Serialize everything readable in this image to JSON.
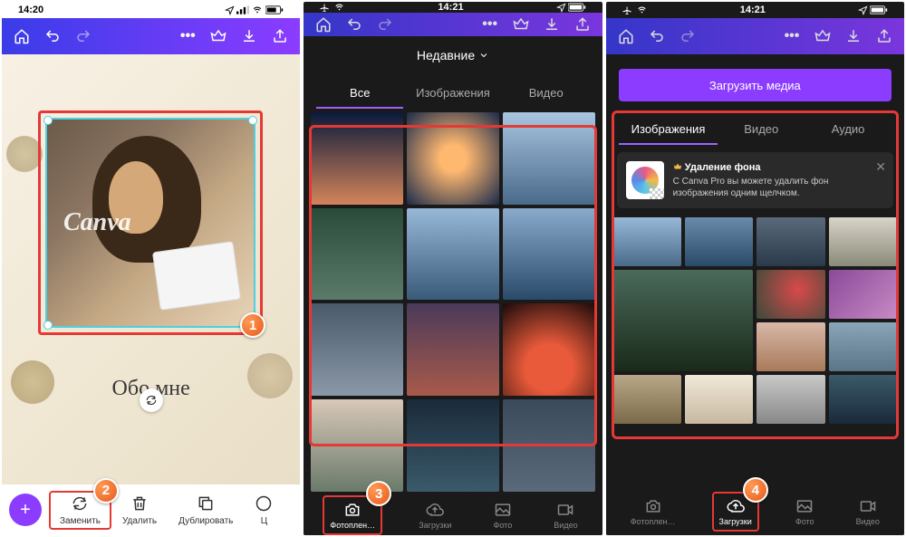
{
  "status": {
    "time1": "14:20",
    "time2": "14:21",
    "time3": "14:21",
    "signal_icon": "signal",
    "wifi_icon": "wifi",
    "battery_icon": "battery",
    "plane_icon": "airplane",
    "location_icon": "location"
  },
  "toolbar": {
    "home": "home",
    "undo": "undo",
    "redo": "redo",
    "more": "•••",
    "crown": "crown",
    "download": "download",
    "share": "share"
  },
  "panel1": {
    "watermark": "Canva",
    "caption": "Обо мне",
    "fab": "+",
    "tools": {
      "replace": "Заменить",
      "delete": "Удалить",
      "duplicate": "Дублировать",
      "color_partial": "Ц"
    },
    "step1": "1",
    "step2": "2"
  },
  "panel2": {
    "dropdown": "Недавние",
    "tabs": {
      "all": "Все",
      "images": "Изображения",
      "video": "Видео"
    },
    "nav": {
      "camera": "Фотоплен…",
      "uploads": "Загрузки",
      "photo": "Фото",
      "video": "Видео"
    },
    "step3": "3"
  },
  "panel3": {
    "upload": "Загрузить медиа",
    "tabs": {
      "images": "Изображения",
      "video": "Видео",
      "audio": "Аудио"
    },
    "promo": {
      "title": "Удаление фона",
      "desc": "С Canva Pro вы можете удалить фон изображения одним щелчком.",
      "close": "✕"
    },
    "nav": {
      "camera": "Фотоплен…",
      "uploads": "Загрузки",
      "photo": "Фото",
      "video": "Видео"
    },
    "step4": "4"
  },
  "thumbs2": [
    "linear-gradient(180deg,#0a1a3a,#d4845a)",
    "radial-gradient(ellipse at center,#ffb870 20%,#1a2a4a)",
    "linear-gradient(180deg,#a8c4e0,#4a6a8a)",
    "linear-gradient(180deg,#2a4a3a,#5a7a6a)",
    "linear-gradient(180deg,#98b8d8,#3a5a7a)",
    "linear-gradient(180deg,#8aaacc,#2a4a6a)",
    "linear-gradient(180deg,#4a5a6a,#8a98a8)",
    "linear-gradient(180deg,#4a3a5a,#a85a4a)",
    "radial-gradient(circle at 50% 70%,#e85a3a 30%,#1a0a0a)",
    "linear-gradient(180deg,#d8c8b8,#6a7a6a)",
    "linear-gradient(180deg,#1a2a3a,#3a5a6a)",
    "linear-gradient(180deg,#3a4a5a,#5a6a7a)"
  ],
  "thumbs3": [
    {
      "bg": "linear-gradient(180deg,#98b8d8,#4a6a8a)",
      "cls": ""
    },
    {
      "bg": "linear-gradient(180deg,#6a8aaa,#2a4a6a)",
      "cls": ""
    },
    {
      "bg": "linear-gradient(180deg,#5a6a7a,#2a3a4a)",
      "cls": ""
    },
    {
      "bg": "linear-gradient(180deg,#d8d4c8,#8a8a7a)",
      "cls": ""
    },
    {
      "bg": "linear-gradient(180deg,#4a6a5a,#1a2a1a)",
      "cls": "span2w span2h"
    },
    {
      "bg": "radial-gradient(circle at 60% 40%,#d84a4a,#3a4a3a)",
      "cls": ""
    },
    {
      "bg": "linear-gradient(135deg,#8a4a9a,#c88ac4)",
      "cls": ""
    },
    {
      "bg": "linear-gradient(180deg,#d8b8a8,#a87a5a)",
      "cls": ""
    },
    {
      "bg": "linear-gradient(180deg,#8aa4b8,#5a7488)",
      "cls": ""
    },
    {
      "bg": "linear-gradient(180deg,#b8a888,#7a6a4a)",
      "cls": ""
    },
    {
      "bg": "linear-gradient(180deg,#f0e8d8,#c8b8a0)",
      "cls": ""
    },
    {
      "bg": "linear-gradient(180deg,#c8c8c8,#888)",
      "cls": ""
    },
    {
      "bg": "linear-gradient(180deg,#3a5a6a,#1a2a3a)",
      "cls": ""
    }
  ]
}
